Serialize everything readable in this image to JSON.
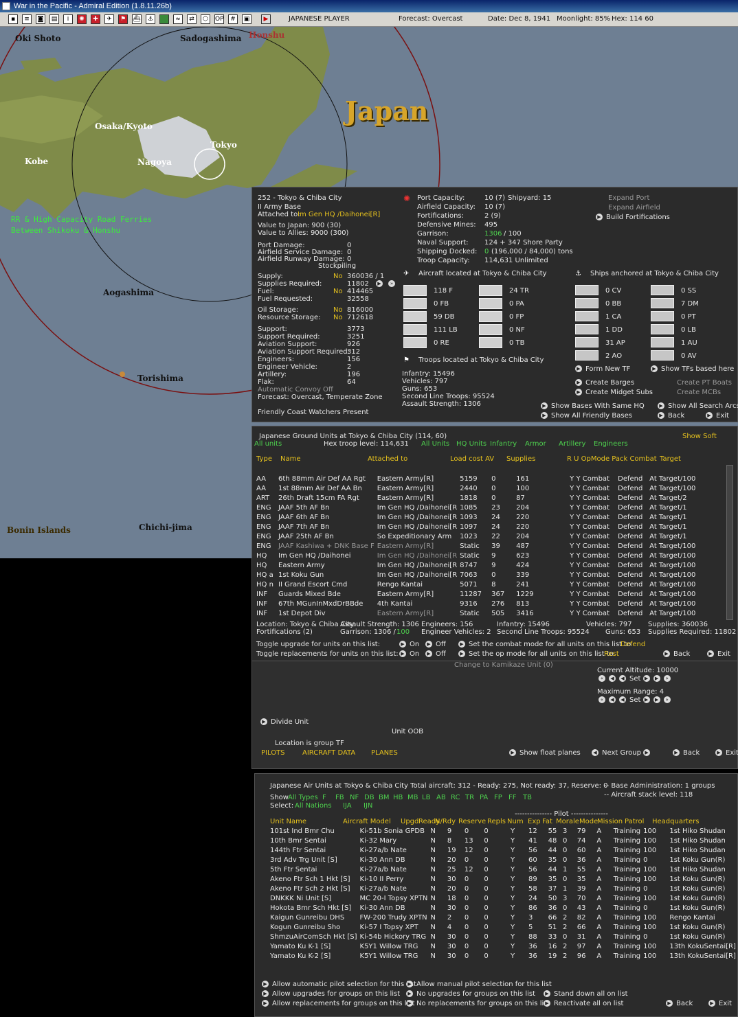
{
  "window": {
    "title": "War in the Pacific - Admiral Edition (1.8.11.26b)"
  },
  "topbar": {
    "player": "JAPANESE PLAYER",
    "forecast": "Forecast: Overcast",
    "date": "Date: Dec 8, 1941",
    "moonlight": "Moonlight: 85%",
    "hex": "Hex: 114 60"
  },
  "map": {
    "labels": [
      "Oki Shoto",
      "Sadogashima",
      "Honshu",
      "Japan",
      "Osaka/Kyoto",
      "Tokyo",
      "Kobe",
      "Nagoya",
      "Aogashima",
      "Torishima",
      "Bonin Islands",
      "Chichi-jima"
    ],
    "note_line1": "RR & High Capacity Road Ferries",
    "note_line2": "Between Shikoku & Honshu"
  },
  "base": {
    "title": "252 - Tokyo & Chiba City",
    "hq": "II Army Base",
    "attached_label": "Attached to:",
    "attached_value": "Im Gen HQ /Daihonei[R]",
    "value_japan": "Value to Japan: 900 (30)",
    "value_allies": "Value to Allies: 9000 (300)",
    "port_damage_label": "Port Damage:",
    "port_damage": "0",
    "af_service_label": "Airfield Service Damage:",
    "af_service": "0",
    "af_runway_label": "Airfield Runway Damage:",
    "af_runway": "0",
    "stockpiling": "Stockpiling",
    "supply_label": "Supply:",
    "supply_no": "No",
    "supply_val": "360036 / 1",
    "supplies_req_label": "Supplies Required:",
    "supplies_req": "11802",
    "fuel_label": "Fuel:",
    "fuel_no": "No",
    "fuel_val": "414465",
    "fuel_req_label": "Fuel Requested:",
    "fuel_req": "32558",
    "oil_label": "Oil Storage:",
    "oil_no": "No",
    "oil_val": "816000",
    "res_label": "Resource Storage:",
    "res_no": "No",
    "res_val": "712618",
    "support_label": "Support:",
    "support": "3773",
    "support_req_label": "Support Required:",
    "support_req": "3251",
    "av_label": "Aviation Support:",
    "av": "926",
    "av_req_label": "Aviation Support Required:",
    "av_req": "312",
    "eng_label": "Engineers:",
    "eng": "156",
    "engv_label": "Engineer Vehicle:",
    "engv": "2",
    "art_label": "Artillery:",
    "art": "196",
    "flak_label": "Flak:",
    "flak": "64",
    "convoy": "Automatic Convoy Off",
    "forecast": "Forecast: Overcast, Temperate Zone",
    "coastwatch": "Friendly Coast Watchers Present",
    "port_cap_label": "Port Capacity:",
    "port_cap": "10 (7)",
    "shipyard": "Shipyard: 15",
    "af_cap_label": "Airfield Capacity:",
    "af_cap": "10 (7)",
    "fort_label": "Fortifications:",
    "fort": "2 (9)",
    "mines_label": "Defensive Mines:",
    "mines": "495",
    "garrison_label": "Garrison:",
    "garrison_a": "1306",
    "garrison_b": "/ 100",
    "naval_label": "Naval Support:",
    "naval": "124 + 347 Shore Party",
    "docked_label": "Shipping Docked:",
    "docked_a": "0",
    "docked_b": "(196,000 / 84,000) tons",
    "troopcap_label": "Troop Capacity:",
    "troopcap": "114,631 Unlimited",
    "expand_port": "Expand Port",
    "expand_af": "Expand Airfield",
    "build_fort": "Build Fortifications",
    "aircraft_title": "Aircraft located at Tokyo & Chiba City",
    "ships_title": "Ships anchored at Tokyo & Chiba City",
    "troops_title": "Troops located at Tokyo & Chiba City",
    "aircraft_a": [
      "118 F",
      "0 FB",
      "59 DB",
      "111 LB",
      "0 RE"
    ],
    "aircraft_b": [
      "24 TR",
      "0 PA",
      "0 FP",
      "0 NF",
      "0 TB"
    ],
    "ships_a": [
      "0 CV",
      "0 BB",
      "1 CA",
      "1 DD",
      "31 AP",
      "2 AO"
    ],
    "ships_b": [
      "0 SS",
      "7 DM",
      "0 PT",
      "0 LB",
      "1 AU",
      "0 AV"
    ],
    "troops": [
      "Infantry: 15496",
      "Vehicles: 797",
      "Guns: 653",
      "Second Line Troops: 95524",
      "Assault Strength: 1306"
    ],
    "form_tf": "Form New TF",
    "show_tfs": "Show TFs based here",
    "create_barges": "Create Barges",
    "create_pt": "Create PT Boats",
    "create_midget": "Create Midget Subs",
    "create_mcb": "Create MCBs",
    "show_same_hq": "Show Bases With Same HQ",
    "show_search": "Show All Search Arcs",
    "show_friendly": "Show All Friendly Bases",
    "back": "Back",
    "exit": "Exit"
  },
  "ground": {
    "title": "Japanese Ground Units at Tokyo & Chiba City  (114, 60)",
    "hex_level": "Hex troop level: 114,631",
    "show_soft": "Show Soft",
    "filters": [
      "All units",
      "All Units",
      "HQ Units",
      "Infantry",
      "Armor",
      "Artillery",
      "Engineers"
    ],
    "headers": [
      "Type",
      "Name",
      "Attached to",
      "Load cost AV",
      "Supplies",
      "R U OpMode Pack Combat",
      "Target"
    ],
    "rows": [
      [
        "AA",
        "6th 88mm Air Def AA Rgt",
        "Eastern Army[R]",
        "5159",
        "0",
        "161",
        "Y Y Combat",
        "Defend",
        "At Target/100"
      ],
      [
        "AA",
        "1st 88mm Air Def AA Bn",
        "Eastern Army[R]",
        "2440",
        "0",
        "100",
        "Y Y Combat",
        "Defend",
        "At Target/100"
      ],
      [
        "ART",
        "26th Draft 15cm FA Rgt",
        "Eastern Army[R]",
        "1818",
        "0",
        "87",
        "Y Y Combat",
        "Defend",
        "At Target/2"
      ],
      [
        "ENG",
        "JAAF 5th AF Bn",
        "Im Gen HQ /Daihonei[R",
        "1085",
        "23",
        "204",
        "Y Y Combat",
        "Defend",
        "At Target/1"
      ],
      [
        "ENG",
        "JAAF 6th AF Bn",
        "Im Gen HQ /Daihonei[R",
        "1093",
        "24",
        "220",
        "Y Y Combat",
        "Defend",
        "At Target/1"
      ],
      [
        "ENG",
        "JAAF 7th AF Bn",
        "Im Gen HQ /Daihonei[R",
        "1097",
        "24",
        "220",
        "Y Y Combat",
        "Defend",
        "At Target/1"
      ],
      [
        "ENG",
        "JAAF 25th AF Bn",
        "So Expeditionary Arm",
        "1023",
        "22",
        "204",
        "Y Y Combat",
        "Defend",
        "At Target/1"
      ],
      [
        "ENG",
        "JAAF Kashiwa + DNK Base F",
        "Eastern Army[R]",
        "Static",
        "39",
        "487",
        "Y Y Combat",
        "Defend",
        "At Target/100"
      ],
      [
        "HQ",
        "Im Gen HQ /Daihonei",
        "Im Gen HQ /Daihonei[R",
        "Static",
        "9",
        "623",
        "Y Y Combat",
        "Defend",
        "At Target/100"
      ],
      [
        "HQ",
        "Eastern Army",
        "Im Gen HQ /Daihonei[R",
        "8747",
        "9",
        "424",
        "Y Y Combat",
        "Defend",
        "At Target/100"
      ],
      [
        "HQ  a",
        "1st Koku Gun",
        "Im Gen HQ /Daihonei[R",
        "7063",
        "0",
        "339",
        "Y Y Combat",
        "Defend",
        "At Target/100"
      ],
      [
        "HQ  n",
        "II Grand Escort Cmd",
        "Rengo Kantai",
        "5071",
        "8",
        "241",
        "Y Y Combat",
        "Defend",
        "At Target/100"
      ],
      [
        "INF",
        "Guards Mixed Bde",
        "Eastern Army[R]",
        "11287",
        "367",
        "1229",
        "Y Y Combat",
        "Defend",
        "At Target/100"
      ],
      [
        "INF",
        "67th MGunInMxdDrBBde",
        "4th Kantai",
        "9316",
        "276",
        "813",
        "Y Y Combat",
        "Defend",
        "At Target/100"
      ],
      [
        "INF",
        "1st Depot Div",
        "Eastern Army[R]",
        "Static",
        "505",
        "3416",
        "Y Y Combat",
        "Defend",
        "At Target/100"
      ]
    ],
    "loc": "Location: Tokyo & Chiba City",
    "fort": "Fortifications (2)",
    "assault": "Assault Strength: 1306",
    "garrison": "Garrison:  1306  /",
    "garrison_b": "100",
    "engineers": "Engineers: 156",
    "engv": "Engineer Vehicles: 2",
    "infantry": "Infantry: 15496",
    "sltroops": "Second Line Troops: 95524",
    "vehicles": "Vehicles: 797",
    "guns": "Guns: 653",
    "supplies": "Supplies: 360036",
    "supplies_req": "Supplies Required: 11802",
    "toggle_upg": "Toggle upgrade for units on this list:",
    "toggle_rep": "Toggle replacements for units on this list:",
    "on": "On",
    "off": "Off",
    "combat_mode": "Set the combat mode for all units on this list to",
    "combat_val": "Defend",
    "op_mode": "Set the op mode for all units on this list to",
    "op_val": "Rest",
    "back": "Back",
    "exit": "Exit"
  },
  "tf": {
    "kamikaze": "Change to Kamikaze Unit (0)",
    "altitude": "Current Altitude: 10000",
    "range": "Maximum Range: 4",
    "set": "Set",
    "divide": "Divide Unit",
    "oob": "Unit OOB",
    "location": "Location is group TF",
    "pilots": "PILOTS",
    "acdata": "AIRCRAFT DATA",
    "planes": "PLANES",
    "float": "Show float planes",
    "next": "Next Group",
    "back": "Back",
    "exit": "Exit"
  },
  "air": {
    "title": "Japanese Air Units at Tokyo & Chiba City   Total aircraft:  312 - Ready:  275, Not ready:  37, Reserve:  0",
    "base_admin": "-- Base Administration: 1 groups",
    "stack": "-- Aircraft stack level: 118",
    "show_label": "Show",
    "show_types": [
      "All Types",
      "F",
      "FB",
      "NF",
      "DB",
      "BM",
      "HB",
      "MB",
      "LB",
      "AB",
      "RC",
      "TR",
      "PA",
      "FP",
      "FF",
      "TB"
    ],
    "select_label": "Select:",
    "select_items": [
      "All Nations",
      "IJA",
      "IJN"
    ],
    "pilot_sep": "--------------- Pilot ---------------",
    "headers": [
      "Unit Name",
      "Aircraft Model",
      "Upgd",
      "Ready",
      "N/Rdy",
      "Reserve",
      "Repls",
      "Num",
      "Exp",
      "Fat",
      "Morale",
      "Mode",
      "Mission",
      "Patrol",
      "Headquarters"
    ],
    "rows": [
      [
        "101st Ind Bmr Chu",
        "Ki-51b Sonia GPDB",
        "N",
        "9",
        "0",
        "0",
        "Y",
        "12",
        "55",
        "3",
        "79",
        "A",
        "Training",
        "100",
        "1st Hiko Shudan"
      ],
      [
        "10th Bmr Sentai",
        "Ki-32 Mary",
        "N",
        "8",
        "13",
        "0",
        "Y",
        "41",
        "48",
        "0",
        "74",
        "A",
        "Training",
        "100",
        "1st Hiko Shudan"
      ],
      [
        "144th Ftr Sentai",
        "Ki-27a/b Nate",
        "N",
        "19",
        "12",
        "0",
        "Y",
        "56",
        "44",
        "0",
        "60",
        "A",
        "Training",
        "100",
        "1st Hiko Shudan"
      ],
      [
        "3rd Adv Trg Unit [S]",
        "Ki-30 Ann DB",
        "N",
        "20",
        "0",
        "0",
        "Y",
        "60",
        "35",
        "0",
        "36",
        "A",
        "Training",
        "0",
        "1st Koku Gun(R)"
      ],
      [
        "5th Ftr Sentai",
        "Ki-27a/b Nate",
        "N",
        "25",
        "12",
        "0",
        "Y",
        "56",
        "44",
        "1",
        "55",
        "A",
        "Training",
        "100",
        "1st Hiko Shudan"
      ],
      [
        "Akeno Ftr Sch 1 Hkt [S]",
        "Ki-10 II Perry",
        "N",
        "30",
        "0",
        "0",
        "Y",
        "89",
        "35",
        "0",
        "35",
        "A",
        "Training",
        "100",
        "1st Koku Gun(R)"
      ],
      [
        "Akeno Ftr Sch 2 Hkt [S]",
        "Ki-27a/b Nate",
        "N",
        "20",
        "0",
        "0",
        "Y",
        "58",
        "37",
        "1",
        "39",
        "A",
        "Training",
        "0",
        "1st Koku Gun(R)"
      ],
      [
        "DNKKK Ni Unit [S]",
        "MC 20-I Topsy XPTN",
        "N",
        "18",
        "0",
        "0",
        "Y",
        "24",
        "50",
        "3",
        "70",
        "A",
        "Training",
        "100",
        "1st Koku Gun(R)"
      ],
      [
        "Hokota Bmr Sch Hkt [S]",
        "Ki-30 Ann DB",
        "N",
        "30",
        "0",
        "0",
        "Y",
        "86",
        "36",
        "0",
        "43",
        "A",
        "Training",
        "0",
        "1st Koku Gun(R)"
      ],
      [
        "Kaigun Gunreibu DHS",
        "FW-200 Trudy XPTN",
        "N",
        "2",
        "0",
        "0",
        "Y",
        "3",
        "66",
        "2",
        "82",
        "A",
        "Training",
        "100",
        "Rengo Kantai"
      ],
      [
        "Kogun Gunreibu Sho",
        "Ki-57 I Topsy XPT",
        "N",
        "4",
        "0",
        "0",
        "Y",
        "5",
        "51",
        "2",
        "66",
        "A",
        "Training",
        "100",
        "1st Koku Gun(R)"
      ],
      [
        "ShmzuAirComSch Hkt [S]",
        "Ki-54b Hickory TRG",
        "N",
        "30",
        "0",
        "0",
        "Y",
        "88",
        "33",
        "0",
        "31",
        "A",
        "Training",
        "0",
        "1st Koku Gun(R)"
      ],
      [
        "Yamato Ku K-1 [S]",
        "K5Y1 Willow TRG",
        "N",
        "30",
        "0",
        "0",
        "Y",
        "36",
        "16",
        "2",
        "97",
        "A",
        "Training",
        "100",
        "13th KokuSentai[R]"
      ],
      [
        "Yamato Ku K-2 [S]",
        "K5Y1 Willow TRG",
        "N",
        "30",
        "0",
        "0",
        "Y",
        "36",
        "19",
        "2",
        "96",
        "A",
        "Training",
        "100",
        "13th KokuSentai[R]"
      ]
    ],
    "auto_pilot": "Allow automatic pilot selection for this list",
    "manual_pilot": "Allow manual pilot selection for this list",
    "allow_upg": "Allow upgrades for groups on this list",
    "no_upg": "No upgrades for groups on this list",
    "stand_down": "Stand down all on list",
    "allow_rep": "Allow replacements for groups on this list",
    "no_rep": "No replacements for groups on this list",
    "reactivate": "Reactivate all on list",
    "back": "Back",
    "exit": "Exit"
  }
}
